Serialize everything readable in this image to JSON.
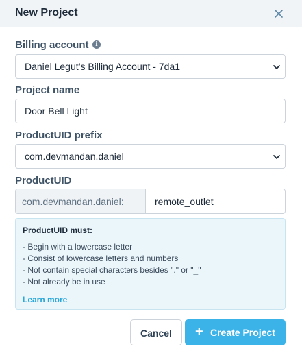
{
  "modal": {
    "title": "New Project"
  },
  "billing": {
    "label": "Billing account",
    "selected": "Daniel Legut’s Billing Account - 7da1"
  },
  "project_name": {
    "label": "Project name",
    "value": "Door Bell Light"
  },
  "product_uid_prefix": {
    "label": "ProductUID prefix",
    "selected": "com.devmandan.daniel"
  },
  "product_uid": {
    "label": "ProductUID",
    "prefix": "com.devmandan.daniel:",
    "value": "remote_outlet"
  },
  "rules": {
    "title": "ProductUID must:",
    "items": [
      "- Begin with a lowercase letter",
      "- Consist of lowercase letters and numbers",
      "- Not contain special characters besides \".\" or \"_\"",
      "- Not already be in use"
    ],
    "learn_more": "Learn more"
  },
  "footer": {
    "cancel_label": "Cancel",
    "create_label": "Create Project"
  },
  "colors": {
    "accent": "#3bb3e8",
    "info_bg": "#ebf6fb",
    "link": "#2aa6d9"
  },
  "icons": {
    "close": "close-icon",
    "info": "info-icon",
    "chevron": "chevron-down-icon",
    "plus": "plus-icon"
  }
}
